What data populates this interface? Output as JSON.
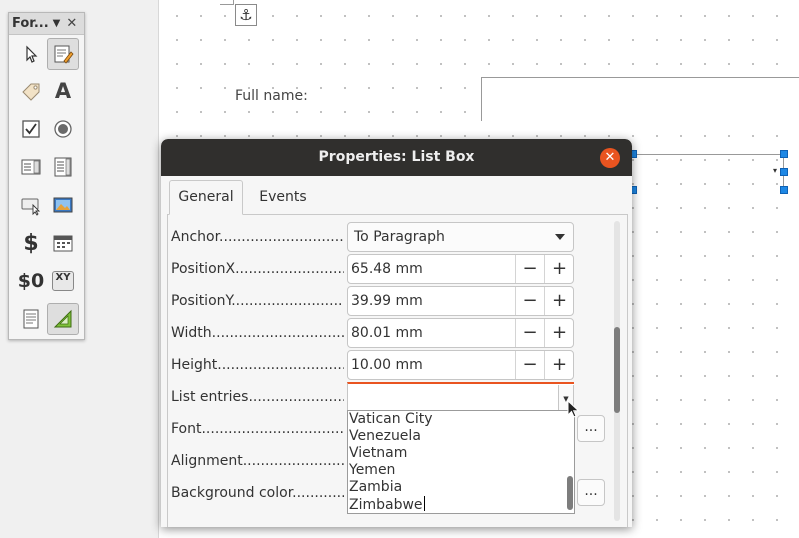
{
  "toolbar": {
    "title": "For...",
    "buttons": [
      {
        "icon": "select-arrow-icon",
        "pressed": false
      },
      {
        "icon": "design-mode-icon",
        "pressed": true
      },
      {
        "icon": "label-tag-icon",
        "pressed": false
      },
      {
        "icon": "text-box-icon",
        "pressed": false
      },
      {
        "icon": "check-box-icon",
        "pressed": false
      },
      {
        "icon": "option-button-icon",
        "pressed": false
      },
      {
        "icon": "list-box-icon",
        "pressed": false
      },
      {
        "icon": "combo-box-icon",
        "pressed": false
      },
      {
        "icon": "push-button-icon",
        "pressed": false
      },
      {
        "icon": "image-button-icon",
        "pressed": false
      },
      {
        "icon": "currency-field-icon",
        "pressed": false
      },
      {
        "icon": "date-field-icon",
        "pressed": false
      },
      {
        "icon": "numeric-field-icon",
        "pressed": false
      },
      {
        "icon": "pattern-field-icon",
        "pressed": false
      },
      {
        "icon": "form-properties-icon",
        "pressed": false
      },
      {
        "icon": "form-wizards-icon",
        "pressed": true
      }
    ],
    "labels": {
      "currency": "$",
      "numeric": "$0",
      "pattern": "XY",
      "text": "A"
    }
  },
  "document": {
    "full_name_label": "Full name:",
    "anchor_glyph": "⚓"
  },
  "dialog": {
    "title": "Properties: List Box",
    "tabs": [
      "General",
      "Events"
    ],
    "active_tab": "General",
    "properties": {
      "anchor": {
        "label": "Anchor................................",
        "value": "To Paragraph"
      },
      "position_x": {
        "label": "PositionX.............................",
        "value": "65.48 mm"
      },
      "position_y": {
        "label": "PositionY.............................",
        "value": "39.99 mm"
      },
      "width": {
        "label": "Width..................................",
        "value": "80.01 mm"
      },
      "height": {
        "label": "Height..................................",
        "value": "10.00 mm"
      },
      "list_entries": {
        "label": "List entries..........................."
      },
      "font": {
        "label": "Font......................................"
      },
      "alignment": {
        "label": "Alignment.............................."
      },
      "background_color": {
        "label": "Background color................"
      }
    },
    "minus": "−",
    "plus": "+",
    "ellipsis": "...",
    "close_glyph": "✕"
  },
  "list_popup": {
    "items": [
      "Vatican City",
      "Venezuela",
      "Vietnam",
      "Yemen",
      "Zambia",
      "Zimbabwe"
    ]
  }
}
